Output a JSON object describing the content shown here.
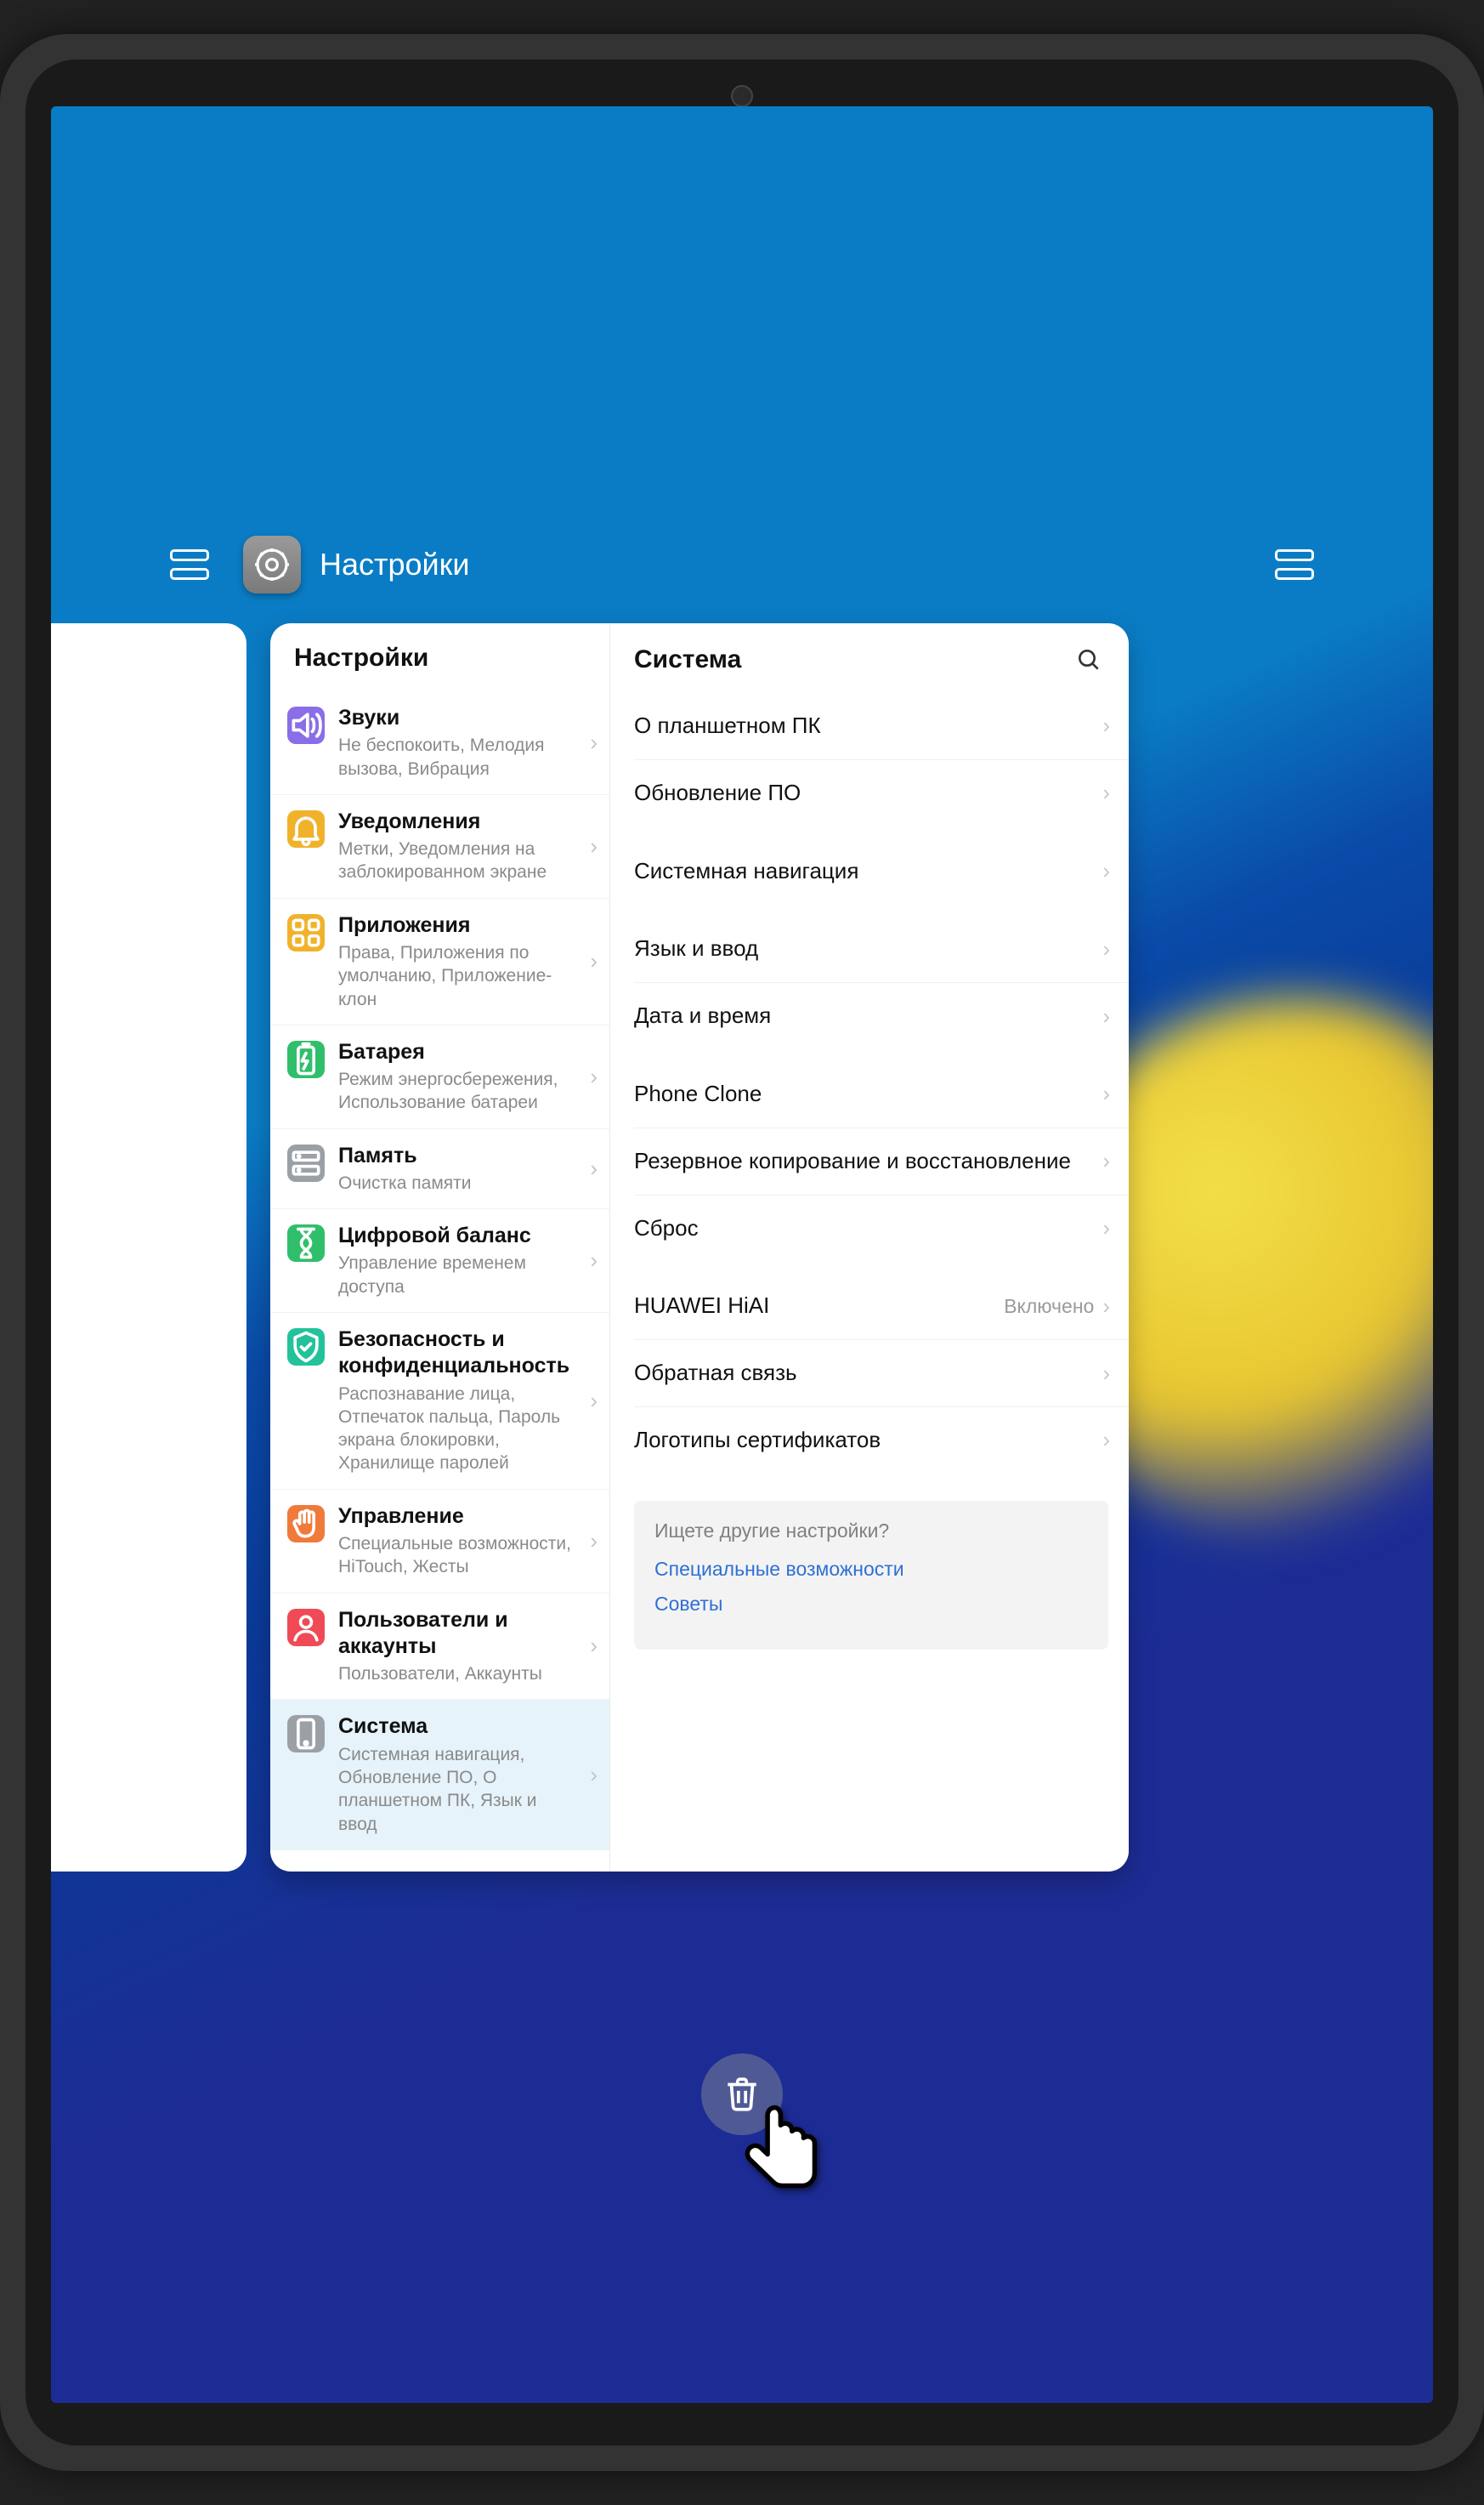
{
  "app": {
    "title": "Настройки"
  },
  "leftPane": {
    "title": "Настройки",
    "items": [
      {
        "icon": "sound",
        "color": "#8a6de8",
        "title": "Звуки",
        "sub": "Не беспокоить, Мелодия вызова, Вибрация"
      },
      {
        "icon": "bell",
        "color": "#f1b22b",
        "title": "Уведомления",
        "sub": "Метки, Уведомления на заблокированном экране"
      },
      {
        "icon": "apps",
        "color": "#f1b22b",
        "title": "Приложения",
        "sub": "Права, Приложения по умолчанию, Приложение-клон"
      },
      {
        "icon": "battery",
        "color": "#2fbf6b",
        "title": "Батарея",
        "sub": "Режим энергосбережения, Использование батареи"
      },
      {
        "icon": "storage",
        "color": "#9aa0a6",
        "title": "Память",
        "sub": "Очистка памяти"
      },
      {
        "icon": "timer",
        "color": "#2fbf6b",
        "title": "Цифровой баланс",
        "sub": "Управление временем доступа"
      },
      {
        "icon": "shield",
        "color": "#23c29b",
        "title": "Безопасность и конфиденциальность",
        "sub": "Распознавание лица, Отпечаток пальца, Пароль экрана блокировки, Хранилище паролей"
      },
      {
        "icon": "hand",
        "color": "#f07a3a",
        "title": "Управление",
        "sub": "Специальные возможности, HiTouch, Жесты"
      },
      {
        "icon": "user",
        "color": "#ef4a56",
        "title": "Пользователи и аккаунты",
        "sub": "Пользователи, Аккаунты"
      },
      {
        "icon": "system",
        "color": "#9aa0a6",
        "title": "Система",
        "sub": "Системная навигация, Обновление ПО, О планшетном ПК, Язык и ввод",
        "selected": true
      }
    ]
  },
  "rightPane": {
    "title": "Система",
    "groups": [
      [
        {
          "label": "О планшетном ПК"
        },
        {
          "label": "Обновление ПО"
        }
      ],
      [
        {
          "label": "Системная навигация"
        }
      ],
      [
        {
          "label": "Язык и ввод"
        },
        {
          "label": "Дата и время"
        }
      ],
      [
        {
          "label": "Phone Clone"
        },
        {
          "label": "Резервное копирование и восстановление"
        },
        {
          "label": "Сброс"
        }
      ],
      [
        {
          "label": "HUAWEI HiAI",
          "value": "Включено"
        },
        {
          "label": "Обратная связь"
        },
        {
          "label": "Логотипы сертификатов"
        }
      ]
    ],
    "hint": {
      "question": "Ищете другие настройки?",
      "links": [
        "Специальные возможности",
        "Советы"
      ]
    }
  }
}
